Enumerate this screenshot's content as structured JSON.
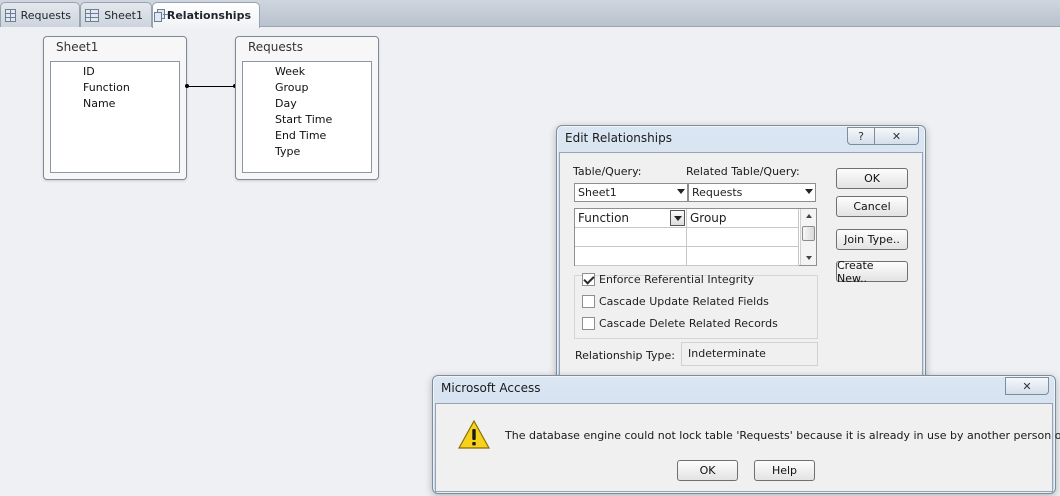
{
  "tabs": [
    {
      "label": "Requests",
      "icon": "table-icon"
    },
    {
      "label": "Sheet1",
      "icon": "table-icon"
    },
    {
      "label": "Relationships",
      "icon": "relationships-icon",
      "active": true
    }
  ],
  "tables": {
    "sheet1": {
      "title": "Sheet1",
      "fields": [
        "ID",
        "Function",
        "Name"
      ]
    },
    "requests": {
      "title": "Requests",
      "fields": [
        "Week",
        "Group",
        "Day",
        "Start Time",
        "End Time",
        "Type"
      ]
    }
  },
  "edit_relationships": {
    "title": "Edit Relationships",
    "help_glyph": "?",
    "close_glyph": "✕",
    "table_query_label": "Table/Query:",
    "related_table_query_label": "Related Table/Query:",
    "table_query_value": "Sheet1",
    "related_table_query_value": "Requests",
    "grid_rows": [
      {
        "left": "Function",
        "right": "Group"
      },
      {
        "left": "",
        "right": ""
      },
      {
        "left": "",
        "right": ""
      }
    ],
    "enforce_ref_integrity": {
      "label": "Enforce Referential Integrity",
      "checked": true
    },
    "cascade_update": {
      "label": "Cascade Update Related Fields",
      "checked": false
    },
    "cascade_delete": {
      "label": "Cascade Delete Related Records",
      "checked": false
    },
    "relationship_type_label": "Relationship Type:",
    "relationship_type_value": "Indeterminate",
    "buttons": {
      "ok": "OK",
      "cancel": "Cancel",
      "join_type": "Join Type..",
      "create_new": "Create New.."
    }
  },
  "message_box": {
    "title": "Microsoft Access",
    "close_glyph": "✕",
    "message": "The database engine could not lock table 'Requests' because it is already in use by another person or process.",
    "buttons": {
      "ok": "OK",
      "help": "Help"
    }
  },
  "colors": {
    "warning_yellow": "#f7d21c",
    "dialog_frame": "#c9d8ea"
  }
}
